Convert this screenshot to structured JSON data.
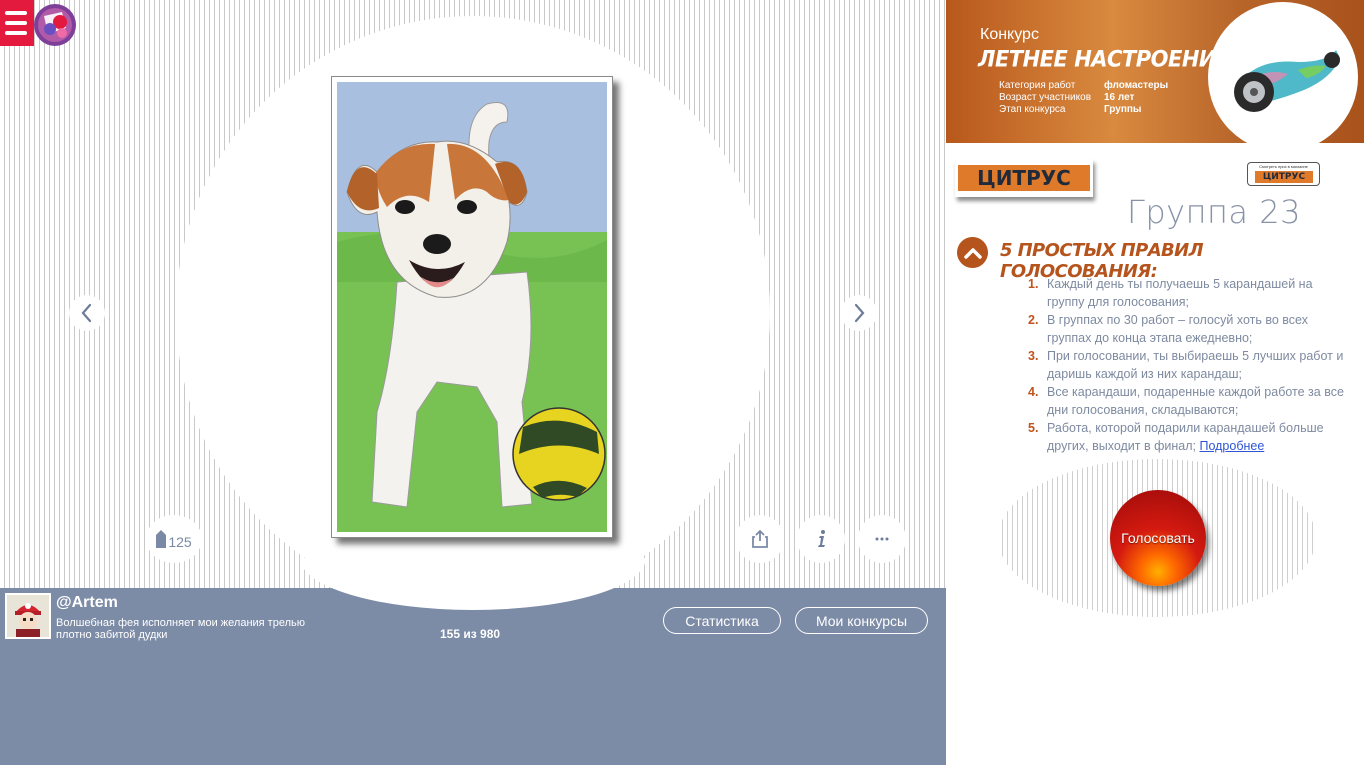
{
  "author": {
    "username": "@Artem",
    "bio": "Волшебная фея исполняет мои желания трелью плотно забитой дудки",
    "rank": "155 из 980"
  },
  "artwork": {
    "pencil_count": "125"
  },
  "buttons": {
    "statistics": "Статистика",
    "my_contests": "Мои конкурсы",
    "vote": "Голосовать"
  },
  "contest": {
    "label": "Конкурс",
    "title": "ЛЕТНЕЕ НАСТРОЕНИЕ",
    "info": [
      {
        "key": "Категория работ",
        "value": "фломастеры"
      },
      {
        "key": "Возраст участников",
        "value": "16 лет"
      },
      {
        "key": "Этап конкурса",
        "value": "Группы"
      }
    ]
  },
  "sponsor": {
    "name": "ЦИТРУС",
    "small_caption": "Смотреть приз в магазине",
    "small_name": "ЦИТРУС"
  },
  "group": {
    "title": "Группа 23"
  },
  "rules": {
    "heading": "5 ПРОСТЫХ ПРАВИЛ ГОЛОСОВАНИЯ:",
    "items": [
      {
        "num": "1.",
        "text": "Каждый день ты получаешь 5 карандашей на группу для голосования;"
      },
      {
        "num": "2.",
        "text": "В группах по 30 работ – голосуй хоть во всех группах до конца этапа ежедневно;"
      },
      {
        "num": "3.",
        "text": "При голосовании, ты выбираешь 5 лучших работ и даришь каждой из них карандаш;"
      },
      {
        "num": "4.",
        "text": "Все карандаши, подаренные каждой работе за все дни голосования, складываются;"
      },
      {
        "num": "5.",
        "text": "Работа, которой подарили карандашей больше других, выходит в финал;"
      }
    ],
    "more_link": "Подробнее"
  },
  "colors": {
    "accent": "#b5541d",
    "menu_red": "#e3193d",
    "author_bar": "#7c8ba6",
    "rule_text": "#7e8aa0"
  },
  "icons": {
    "menu": "hamburger-icon",
    "logo": "app-logo",
    "prev": "chevron-left-icon",
    "next": "chevron-right-icon",
    "pencil": "pencil-icon",
    "share": "share-icon",
    "info": "info-icon",
    "more": "more-dots-icon",
    "rules_toggle": "chevron-up-icon"
  }
}
